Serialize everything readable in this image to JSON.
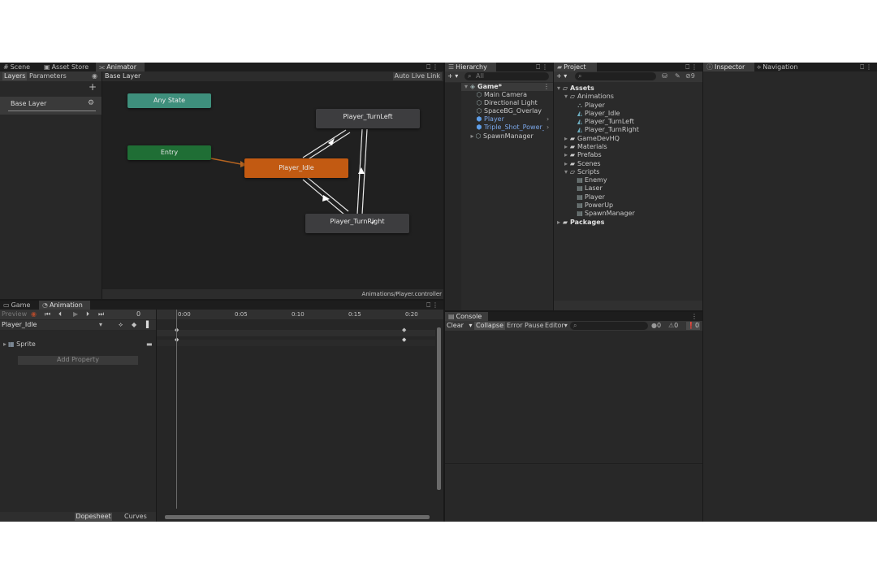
{
  "animator": {
    "tabs": [
      {
        "icon": "#",
        "label": "Scene"
      },
      {
        "icon": "▣",
        "label": "Asset Store"
      },
      {
        "icon": "⫘",
        "label": "Animator"
      }
    ],
    "subtabs": {
      "layers": "Layers",
      "parameters": "Parameters"
    },
    "breadcrumb": "Base Layer",
    "auto_live_link": "Auto Live Link",
    "layer_name": "Base Layer",
    "nodes": {
      "any_state": "Any State",
      "entry": "Entry",
      "idle": "Player_Idle",
      "turn_left": "Player_TurnLeft",
      "turn_right": "Player_TurnRight"
    },
    "controller_path": "Animations/Player.controller",
    "colors": {
      "any_state": "#3e8f7c",
      "entry": "#1f6e35",
      "idle": "#c25a12",
      "state": "#3d3d3f"
    }
  },
  "animation": {
    "tabs": [
      {
        "icon": "▭",
        "label": "Game"
      },
      {
        "icon": "◔",
        "label": "Animation"
      }
    ],
    "preview": "Preview",
    "frame": "0",
    "clip": "Player_Idle",
    "timeline_ticks": [
      "0:00",
      "0:05",
      "0:10",
      "0:15",
      "0:20"
    ],
    "property": "Sprite",
    "add_property": "Add Property",
    "dopesheet": "Dopesheet",
    "curves": "Curves"
  },
  "hierarchy": {
    "tab": "Hierarchy",
    "search_placeholder": "All",
    "scene": "Game*",
    "items": [
      "Main Camera",
      "Directional Light",
      "SpaceBG_Overlay",
      "Player",
      "Triple_Shot_Power_U",
      "SpawnManager"
    ]
  },
  "project": {
    "tab": "Project",
    "root": "Assets",
    "animations_folder": "Animations",
    "animation_items": [
      "Player",
      "Player_Idle",
      "Player_TurnLeft",
      "Player_TurnRight"
    ],
    "folders": [
      "GameDevHQ",
      "Materials",
      "Prefabs",
      "Scenes"
    ],
    "scripts_folder": "Scripts",
    "scripts": [
      "Enemy",
      "Laser",
      "Player",
      "PowerUp",
      "SpawnManager"
    ],
    "packages": "Packages",
    "hidden_count": "9"
  },
  "inspector": {
    "tab": "Inspector",
    "navigation_tab": "Navigation"
  },
  "console": {
    "tab": "Console",
    "clear": "Clear",
    "collapse": "Collapse",
    "error_pause": "Error Pause",
    "editor": "Editor",
    "log_count": "0",
    "warn_count": "0",
    "error_count": "0"
  }
}
